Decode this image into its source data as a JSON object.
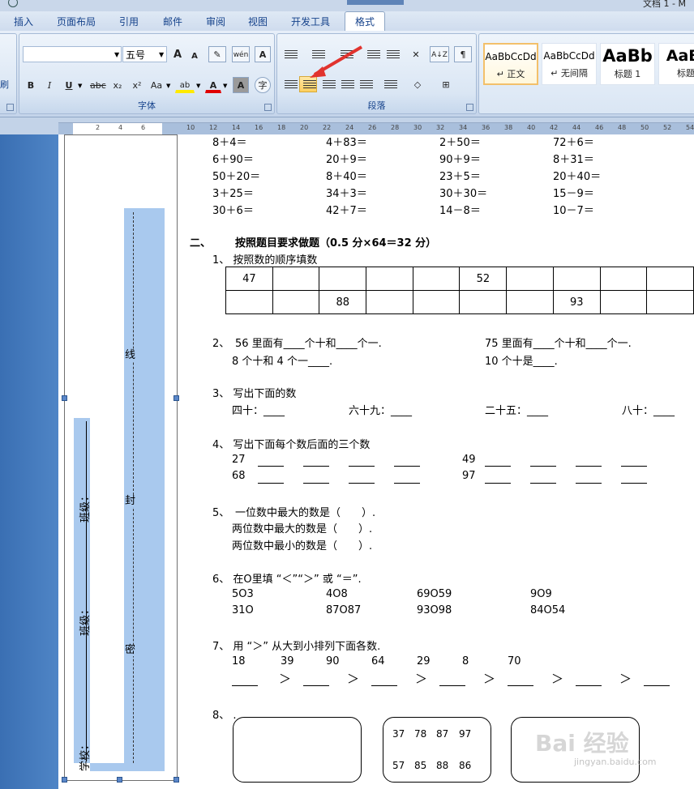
{
  "window": {
    "title_fragment": "文档 1 - M"
  },
  "tabs": [
    {
      "label": "插入",
      "active": false
    },
    {
      "label": "页面布局",
      "active": false
    },
    {
      "label": "引用",
      "active": false
    },
    {
      "label": "邮件",
      "active": false
    },
    {
      "label": "审阅",
      "active": false
    },
    {
      "label": "视图",
      "active": false
    },
    {
      "label": "开发工具",
      "active": false
    },
    {
      "label": "格式",
      "active": true
    }
  ],
  "ribbon": {
    "clipboard_fragment": "刷",
    "font_group": {
      "label": "字体",
      "font_name": "",
      "font_size": "五号",
      "bold": "B",
      "italic": "I",
      "underline": "U",
      "strike": "abc",
      "subscript": "x₂",
      "superscript": "x²",
      "change_case": "Aa",
      "grow": "A",
      "shrink": "A",
      "char_border": "A",
      "char_shade": "A"
    },
    "paragraph_group": {
      "label": "段落",
      "sort": "A↓Z"
    },
    "styles": [
      {
        "preview": "AaBbCcDd",
        "name": "↵ 正文"
      },
      {
        "preview": "AaBbCcDd",
        "name": "↵ 无间隔"
      },
      {
        "preview": "AaBb",
        "name": "标题 1"
      },
      {
        "preview": "AaBl",
        "name": "标题"
      }
    ],
    "accent": "#ffcf5f"
  },
  "ruler": [
    "2",
    "4",
    "6",
    "10",
    "12",
    "14",
    "16",
    "18",
    "20",
    "22",
    "24",
    "26",
    "28",
    "30",
    "32",
    "34",
    "36",
    "38",
    "40",
    "42",
    "44",
    "46",
    "48",
    "50",
    "52",
    "54"
  ],
  "side_binding": {
    "labels": [
      "线",
      "封",
      "密"
    ],
    "fields": [
      "班级：",
      "班级：",
      "学校："
    ]
  },
  "doc": {
    "arith": [
      [
        "8＋4＝",
        "4＋83＝",
        "2＋50＝",
        "72＋6＝"
      ],
      [
        "6＋90＝",
        "20＋9＝",
        "90＋9＝",
        "8＋31＝"
      ],
      [
        "50＋20＝",
        "8＋40＝",
        "23＋5＝",
        "20＋40＝"
      ],
      [
        "3＋25＝",
        "34＋3＝",
        "30＋30＝",
        "15－9＝"
      ],
      [
        "30＋6＝",
        "42＋7＝",
        "14－8＝",
        "10－7＝"
      ]
    ],
    "section2": {
      "num": "二、",
      "title": "按照题目要求做题（0.5 分×64＝32 分）"
    },
    "q1": {
      "label": "1、 按照数的顺序填数",
      "row1": [
        "47",
        "",
        "",
        "",
        "",
        "52",
        "",
        "",
        "",
        ""
      ],
      "row2": [
        "",
        "",
        "88",
        "",
        "",
        "",
        "",
        "93",
        "",
        ""
      ]
    },
    "q2": {
      "num": "2、",
      "a1": "56 里面有____个十和____个一.",
      "a2": "8 个十和 4 个一____.",
      "b1": "75 里面有____个十和____个一.",
      "b2": "10 个十是____."
    },
    "q3": {
      "label": "3、 写出下面的数",
      "items": [
        "四十：____",
        "六十九：____",
        "二十五：____",
        "八十：____"
      ]
    },
    "q4": {
      "label": "4、 写出下面每个数后面的三个数",
      "row1a": "27",
      "row1b": "49",
      "row2a": "68",
      "row2b": "97"
    },
    "q5": {
      "num": "5、",
      "lines": [
        "一位数中最大的数是（　　）.",
        "两位数中最大的数是（　　）.",
        "两位数中最小的数是（　　）."
      ]
    },
    "q6": {
      "label": "6、 在O里填 “＜”“＞” 或 “＝”.",
      "row1": [
        "5O3",
        "4O8",
        "69O59",
        "9O9"
      ],
      "row2": [
        "31O",
        "87O87",
        "93O98",
        "84O54"
      ]
    },
    "q7": {
      "label": "7、 用 “＞” 从大到小排列下面各数.",
      "nums": [
        "18",
        "39",
        "90",
        "64",
        "29",
        "8",
        "70"
      ],
      "gt": "＞"
    },
    "q8": {
      "label": "8、 .",
      "grid": [
        [
          "37",
          "78",
          "87",
          "97"
        ],
        [
          "57",
          "85",
          "88",
          "86"
        ]
      ]
    },
    "watermark_main": "Bai 经验",
    "watermark_url": "jingyan.baidu.com"
  }
}
